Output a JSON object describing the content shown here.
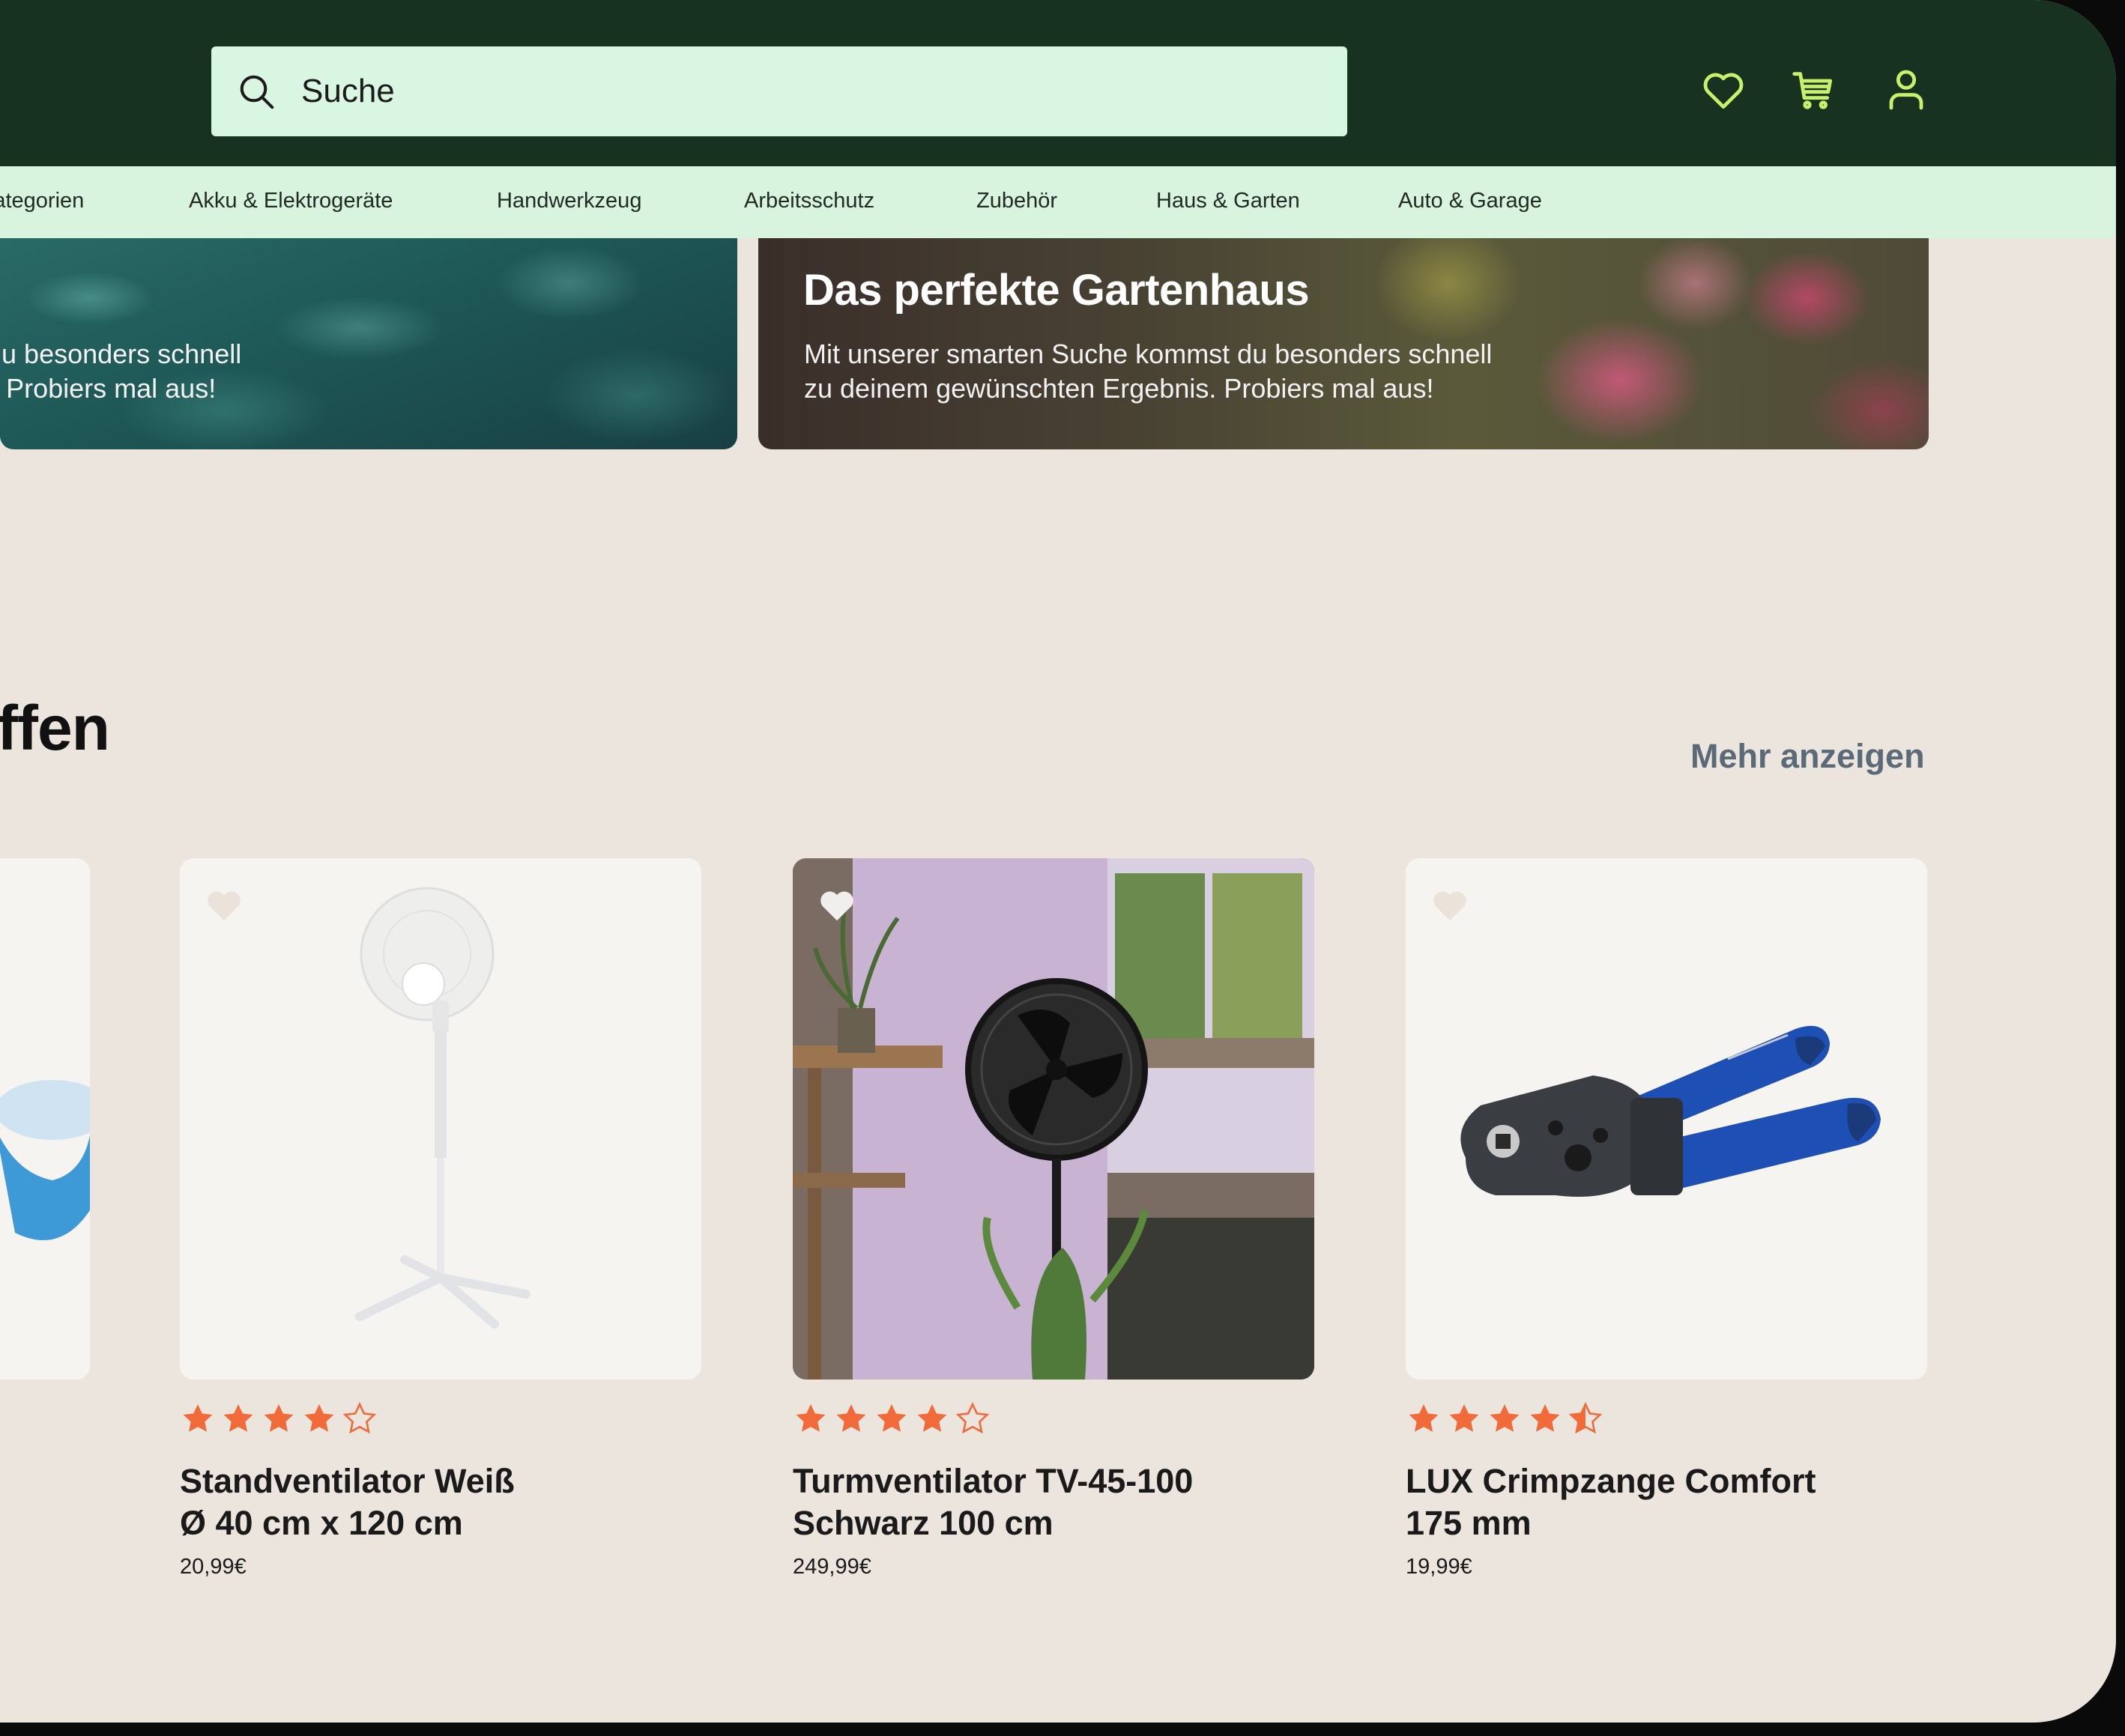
{
  "search": {
    "placeholder": "Suche"
  },
  "header_icons": [
    "heart-icon",
    "cart-icon",
    "user-icon"
  ],
  "categories": [
    "Kategorien",
    "Akku & Elektrogeräte",
    "Handwerkzeug",
    "Arbeitsschutz",
    "Zubehör",
    "Haus & Garten",
    "Auto & Garage"
  ],
  "banners": [
    {
      "subtitle": "kommst du besonders schnell\nErgebnis. Probiers mal aus!"
    },
    {
      "title": "Das perfekte Gartenhaus",
      "subtitle": "Mit unserer smarten Suche kommst du besonders schnell\nzu deinem gewünschten Ergebnis. Probiers mal aus!"
    }
  ],
  "section": {
    "title": "ffen",
    "more_label": "Mehr anzeigen"
  },
  "products": [
    {
      "name": "Standventilator Weiß\nØ 40 cm x 120 cm",
      "price": "20,99€",
      "rating": 4
    },
    {
      "name": "Turmventilator TV-45-100\nSchwarz 100 cm",
      "price": "249,99€",
      "rating": 4
    },
    {
      "name": "LUX Crimpzange Comfort\n175 mm",
      "price": "19,99€",
      "rating": 4.5
    }
  ],
  "colors": {
    "header_bg": "#173221",
    "nav_bg": "#d8f4de",
    "page_bg": "#ebe5de",
    "star": "#f06a3a",
    "link": "#5b6a78",
    "header_icon": "#c8f06a"
  }
}
